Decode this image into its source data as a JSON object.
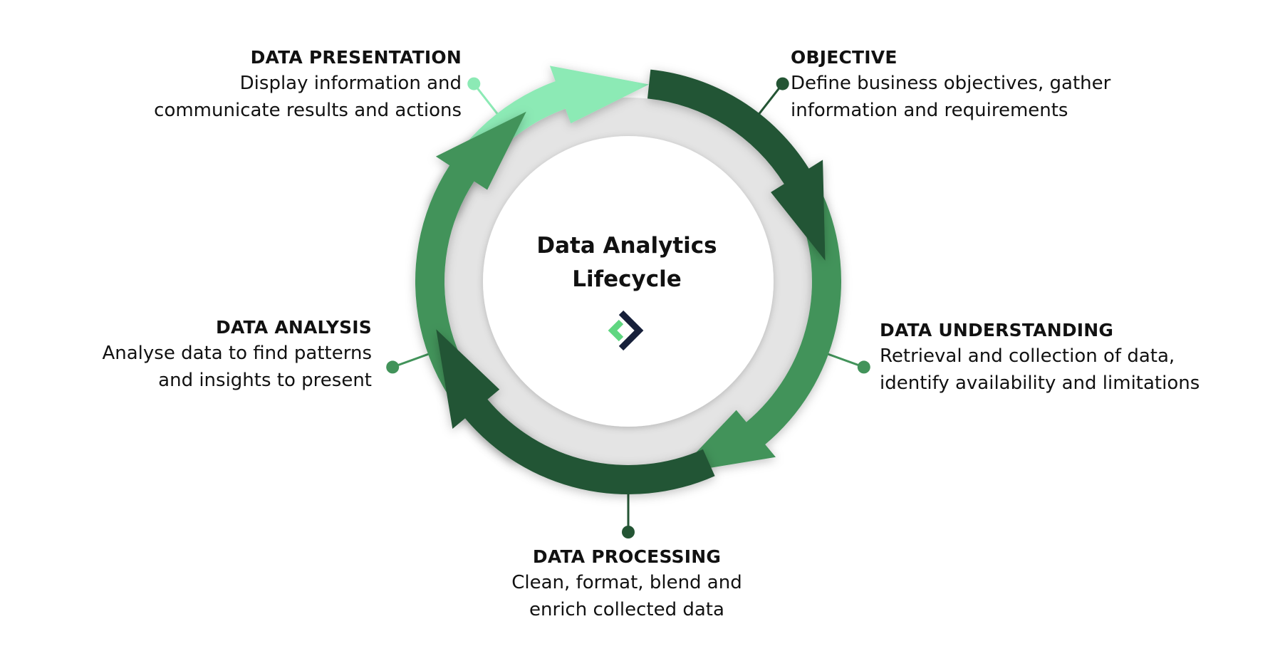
{
  "title": "Data Analytics Lifecycle",
  "colors": {
    "dark_green": "#245534",
    "mid_green": "#42935a",
    "light_green": "#8ceab5",
    "logo_dark": "#17203a",
    "logo_green": "#5fd680",
    "inner_ring": "#e4e4e4"
  },
  "stages": [
    {
      "title": "OBJECTIVE",
      "description_lines": [
        "Define business objectives, gather",
        "information and requirements"
      ]
    },
    {
      "title": "DATA UNDERSTANDING",
      "description_lines": [
        "Retrieval and collection of data,",
        "identify availability and limitations"
      ]
    },
    {
      "title": "DATA PROCESSING",
      "description_lines": [
        "Clean, format, blend and",
        "enrich collected data"
      ]
    },
    {
      "title": "DATA ANALYSIS",
      "description_lines": [
        "Analyse data to find patterns",
        "and insights to present"
      ]
    },
    {
      "title": "DATA PRESENTATION",
      "description_lines": [
        "Display information and",
        "communicate results and actions"
      ]
    }
  ]
}
